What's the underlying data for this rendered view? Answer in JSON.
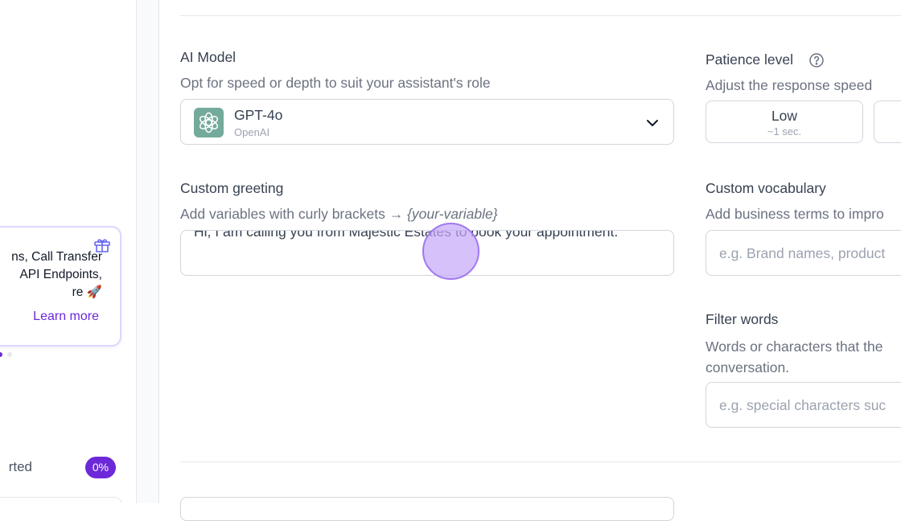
{
  "sidebar": {
    "promo": {
      "lines": [
        "ns, Call Transfer",
        "API Endpoints,",
        "re 🚀"
      ],
      "learn_more": "Learn more"
    },
    "getting_started": "rted",
    "progress_badge": "0%"
  },
  "ai_model": {
    "label": "AI Model",
    "description": "Opt for speed or depth to suit your assistant's role",
    "selected_model": "GPT-4o",
    "selected_provider": "OpenAI"
  },
  "custom_greeting": {
    "label": "Custom greeting",
    "description_prefix": "Add variables with curly brackets → ",
    "description_var": "{your-variable}",
    "value": "Hi, I am calling you from Majestic Estates to book your appointment."
  },
  "patience": {
    "label": "Patience level",
    "description": "Adjust the response speed",
    "options": [
      {
        "title": "Low",
        "sub": "~1 sec."
      }
    ]
  },
  "custom_vocabulary": {
    "label": "Custom vocabulary",
    "description": "Add business terms to impro",
    "placeholder": "e.g. Brand names, product"
  },
  "filter_words": {
    "label": "Filter words",
    "description": "Words or characters that the conversation.",
    "placeholder": "e.g. special characters suc"
  },
  "colors": {
    "accent": "#6d28d9",
    "accent_light": "#ddd6fe",
    "openai_green": "#74aa9c"
  },
  "icons": [
    "gift-icon",
    "openai-logo-icon",
    "chevron-down-icon",
    "help-circle-icon"
  ]
}
